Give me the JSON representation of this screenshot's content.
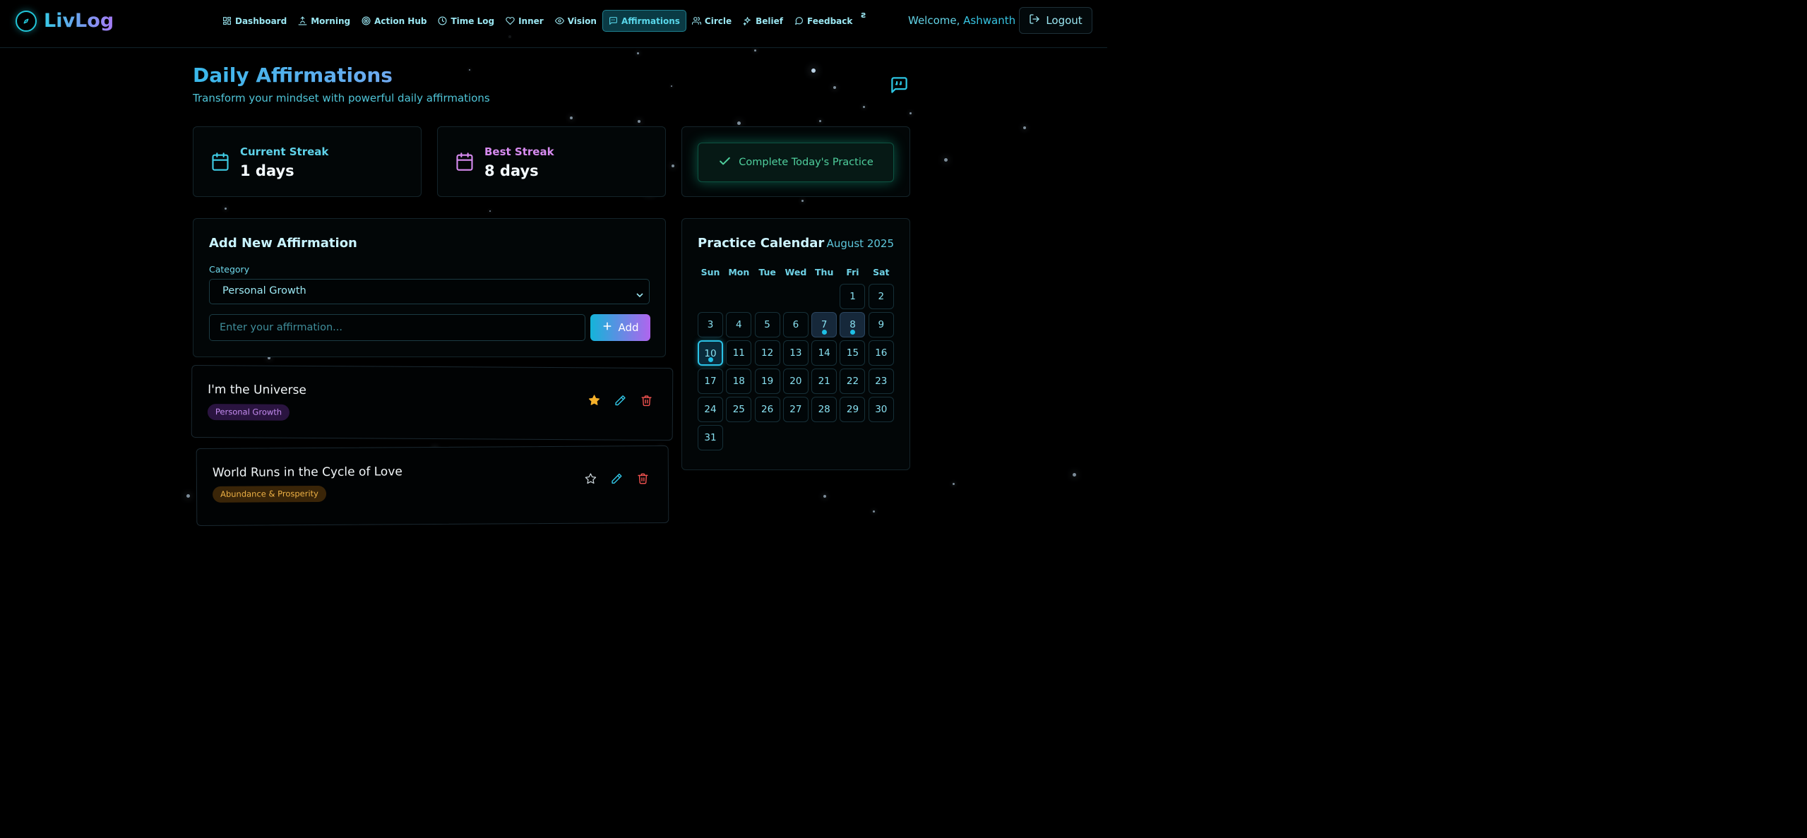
{
  "app": {
    "name": "LivLog"
  },
  "nav": {
    "items": [
      {
        "label": "Dashboard",
        "icon": "dashboard-icon"
      },
      {
        "label": "Morning",
        "icon": "sunrise-icon"
      },
      {
        "label": "Action Hub",
        "icon": "target-icon"
      },
      {
        "label": "Time Log",
        "icon": "clock-icon"
      },
      {
        "label": "Inner",
        "icon": "heart-icon"
      },
      {
        "label": "Vision",
        "icon": "eye-icon"
      },
      {
        "label": "Affirmations",
        "icon": "message-quote-icon",
        "active": true
      },
      {
        "label": "Circle",
        "icon": "users-icon"
      },
      {
        "label": "Belief",
        "icon": "sparkles-icon"
      },
      {
        "label": "Feedback",
        "icon": "message-circle-icon"
      }
    ],
    "overflow": "ƨ"
  },
  "user": {
    "welcome_prefix": "Welcome,",
    "name": "Ashwanth",
    "logout_label": "Logout"
  },
  "header": {
    "title": "Daily Affirmations",
    "subtitle": "Transform your mindset with powerful daily affirmations"
  },
  "stats": {
    "current": {
      "label": "Current Streak",
      "value": "1 days",
      "color": "#5fd3ea"
    },
    "best": {
      "label": "Best Streak",
      "value": "8 days",
      "color": "#d78bf0"
    }
  },
  "practice": {
    "label": "Complete Today's Practice"
  },
  "form": {
    "title": "Add New Affirmation",
    "category_label": "Category",
    "category_value": "Personal Growth",
    "input_placeholder": "Enter your affirmation...",
    "add_label": "Add"
  },
  "affirmations": [
    {
      "text": "I'm the Universe",
      "category": "Personal Growth",
      "favorite": true,
      "tag_bg": "#2a1440",
      "tag_fg": "#c48bf0"
    },
    {
      "text": "World Runs in the Cycle of Love",
      "category": "Abundance & Prosperity",
      "favorite": false,
      "tag_bg": "#3a2508",
      "tag_fg": "#eeb145"
    }
  ],
  "calendar": {
    "title": "Practice Calendar",
    "month": "August 2025",
    "weekdays": [
      "Sun",
      "Mon",
      "Tue",
      "Wed",
      "Thu",
      "Fri",
      "Sat"
    ],
    "leading_blanks": 5,
    "days": [
      "1",
      "2",
      "3",
      "4",
      "5",
      "6",
      "7",
      "8",
      "9",
      "10",
      "11",
      "12",
      "13",
      "14",
      "15",
      "16",
      "17",
      "18",
      "19",
      "20",
      "21",
      "22",
      "23",
      "24",
      "25",
      "26",
      "27",
      "28",
      "29",
      "30",
      "31"
    ],
    "practiced": [
      "7",
      "8",
      "10"
    ],
    "today": "10"
  },
  "colors": {
    "accent": "#22c7d9",
    "purple": "#a57af5",
    "success": "#4fcf9d",
    "danger": "#f0524f",
    "star": "#f5b02a"
  }
}
